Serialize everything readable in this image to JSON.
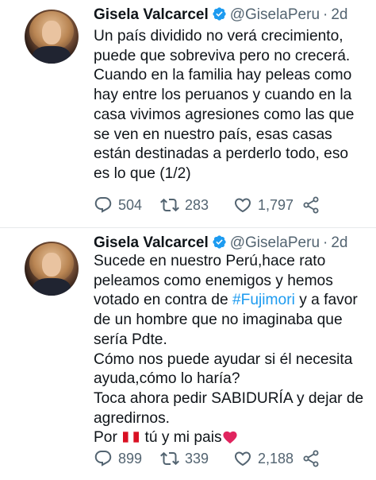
{
  "tweets": [
    {
      "author": "Gisela Valcarcel",
      "handle": "@GiselaPeru",
      "separator": "·",
      "time": "2d",
      "lines": [
        "Un país dividido no verá crecimiento,",
        "puede que sobreviva pero no crecerá.",
        "Cuando en la familia hay peleas como",
        "hay entre los peruanos y cuando en la",
        "casa vivimos agresiones como las que",
        "se ven en nuestro país, esas casas",
        "están destinadas a perderlo todo, eso",
        "es lo que (1/2)"
      ],
      "replies": "504",
      "retweets": "283",
      "likes": "1,797"
    },
    {
      "author": "Gisela Valcarcel",
      "handle": "@GiselaPeru",
      "separator": "·",
      "time": "2d",
      "line1": "Sucede en nuestro Perú,hace rato",
      "line2": "peleamos como enemigos y hemos",
      "line3_before": "votado en contra de ",
      "line3_hashtag": "#Fujimori",
      "line3_after": " y a favor",
      "line4": "de un hombre que no imaginaba que",
      "line5": "sería Pdte.",
      "line6": "Cómo nos puede ayudar si él necesita",
      "line7": "ayuda,cómo lo haría?",
      "line8": "Toca ahora pedir SABIDURÍA y dejar de",
      "line9": "agredirnos.",
      "line10_before": "Por ",
      "line10_after": " tú y mi pais",
      "replies": "899",
      "retweets": "339",
      "likes": "2,188"
    }
  ],
  "icons": {
    "verified": "verified-badge-icon",
    "reply": "reply-icon",
    "retweet": "retweet-icon",
    "like": "heart-icon",
    "share": "share-icon",
    "flag": "peru-flag-emoji",
    "heart_emoji": "red-heart-emoji"
  },
  "colors": {
    "verified": "#1d9bf0",
    "hashtag": "#1d9bf0",
    "secondary_text": "#536471",
    "flag_red": "#d91023",
    "heart_red": "#e0245e"
  }
}
